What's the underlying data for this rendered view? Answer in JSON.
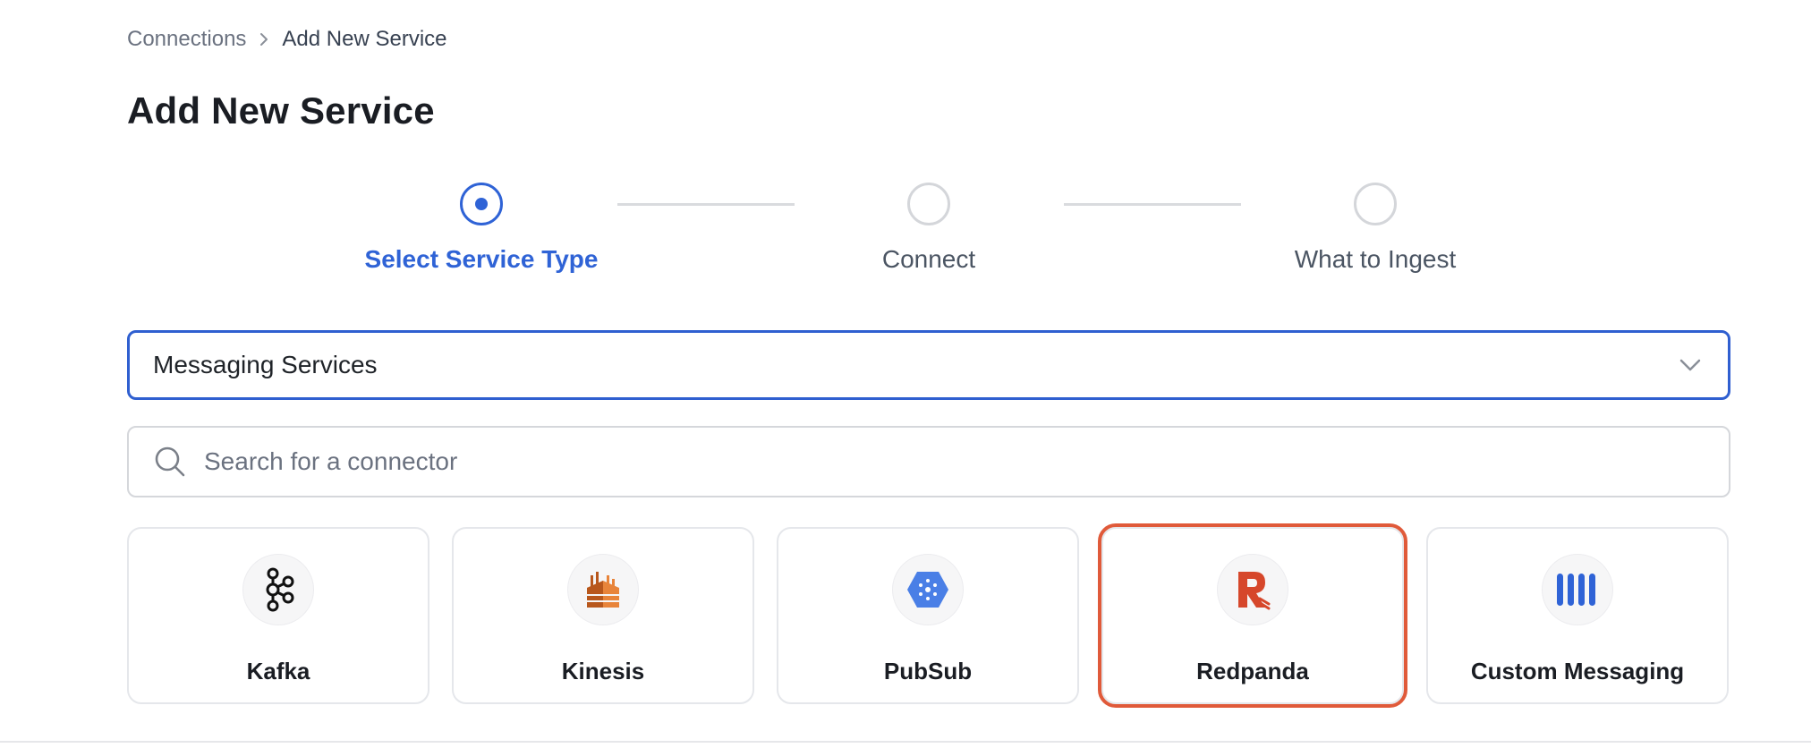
{
  "breadcrumb": {
    "items": [
      "Connections",
      "Add New Service"
    ]
  },
  "page": {
    "title": "Add New Service"
  },
  "stepper": {
    "steps": [
      {
        "label": "Select Service Type",
        "state": "active"
      },
      {
        "label": "Connect",
        "state": "inactive"
      },
      {
        "label": "What to Ingest",
        "state": "inactive"
      }
    ]
  },
  "service_category": {
    "selected": "Messaging Services"
  },
  "search": {
    "placeholder": "Search for a connector",
    "value": ""
  },
  "connectors": [
    {
      "label": "Kafka",
      "icon": "kafka-icon"
    },
    {
      "label": "Kinesis",
      "icon": "kinesis-icon"
    },
    {
      "label": "PubSub",
      "icon": "pubsub-icon"
    },
    {
      "label": "Redpanda",
      "icon": "redpanda-icon",
      "highlighted": true
    },
    {
      "label": "Custom Messaging",
      "icon": "custom-messaging-icon"
    }
  ],
  "colors": {
    "accent": "#2f63d6",
    "highlight": "#e05a3a"
  }
}
